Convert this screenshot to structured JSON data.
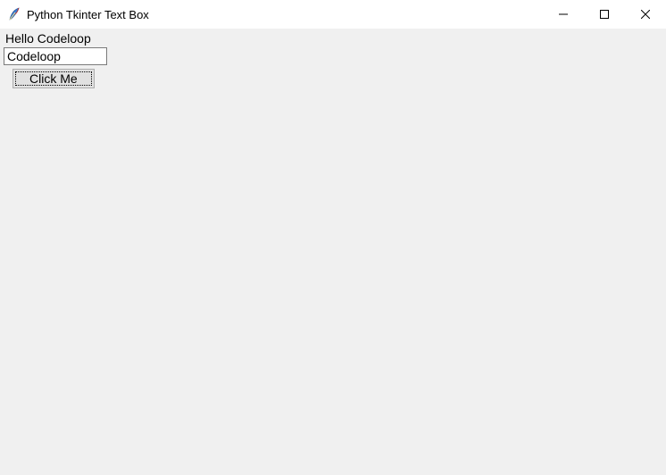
{
  "window": {
    "title": "Python Tkinter Text Box"
  },
  "content": {
    "label_text": "Hello Codeloop",
    "entry_value": "Codeloop",
    "button_label": "Click Me"
  }
}
